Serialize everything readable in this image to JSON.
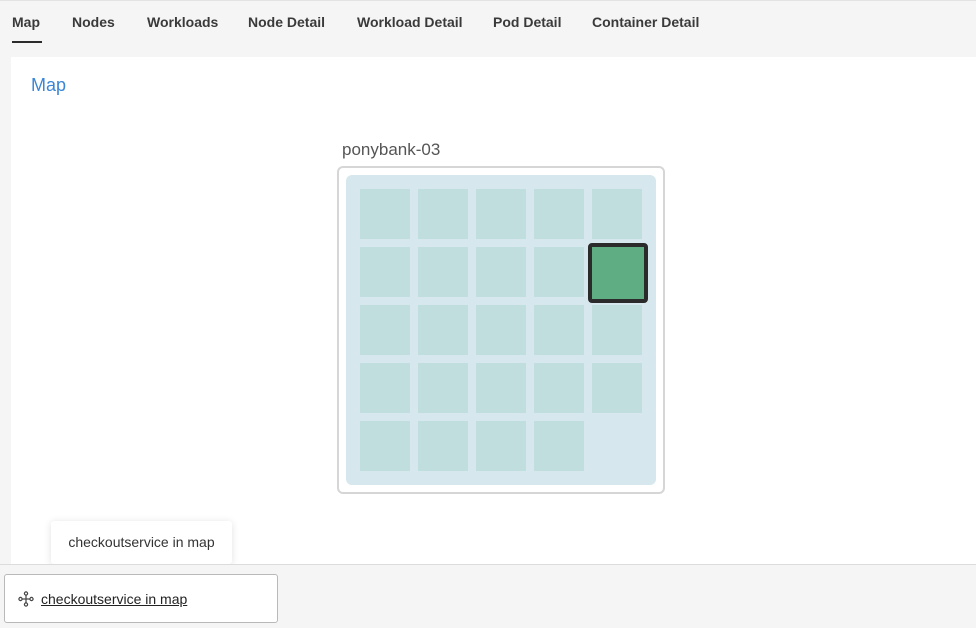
{
  "tabs": [
    {
      "label": "Map",
      "active": true
    },
    {
      "label": "Nodes",
      "active": false
    },
    {
      "label": "Workloads",
      "active": false
    },
    {
      "label": "Node Detail",
      "active": false
    },
    {
      "label": "Workload Detail",
      "active": false
    },
    {
      "label": "Pod Detail",
      "active": false
    },
    {
      "label": "Container Detail",
      "active": false
    }
  ],
  "panel": {
    "title": "Map",
    "node": {
      "name": "ponybank-03",
      "grid_rows": 5,
      "grid_cols": 5,
      "pod_count": 24,
      "highlighted_pod_index": 9
    }
  },
  "tooltip": {
    "text": "checkoutservice in map"
  },
  "bottom_bar": {
    "link_label": "checkoutservice in map",
    "icon": "map-nodes-icon"
  },
  "colors": {
    "accent": "#3b86d6",
    "pod": "#bfdedd",
    "pod_highlight": "#5fae83",
    "node_bg": "#d6e8ee"
  }
}
